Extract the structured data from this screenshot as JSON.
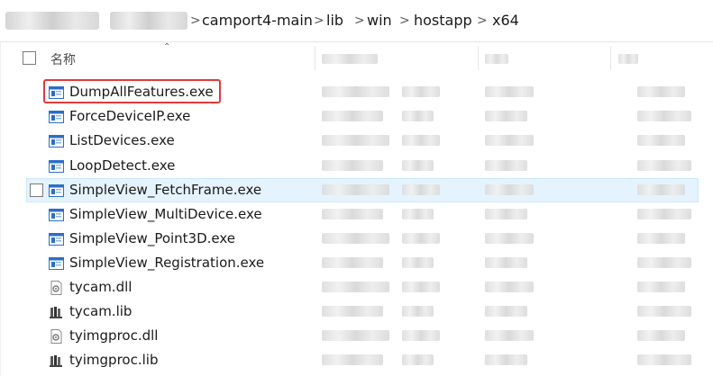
{
  "breadcrumb": {
    "items": [
      "camport4-main",
      "lib",
      "win",
      "hostapp",
      "x64"
    ],
    "separator": ">"
  },
  "columns": {
    "name_label": "名称"
  },
  "files": [
    {
      "name": "DumpAllFeatures.exe",
      "icon": "exe-window-icon",
      "highlighted": true
    },
    {
      "name": "ForceDeviceIP.exe",
      "icon": "exe-window-icon"
    },
    {
      "name": "ListDevices.exe",
      "icon": "exe-window-icon"
    },
    {
      "name": "LoopDetect.exe",
      "icon": "exe-window-icon"
    },
    {
      "name": "SimpleView_FetchFrame.exe",
      "icon": "exe-window-icon",
      "selected": true
    },
    {
      "name": "SimpleView_MultiDevice.exe",
      "icon": "exe-window-icon"
    },
    {
      "name": "SimpleView_Point3D.exe",
      "icon": "exe-window-icon"
    },
    {
      "name": "SimpleView_Registration.exe",
      "icon": "exe-window-icon"
    },
    {
      "name": "tycam.dll",
      "icon": "dll-gear-icon"
    },
    {
      "name": "tycam.lib",
      "icon": "lib-archive-icon"
    },
    {
      "name": "tyimgproc.dll",
      "icon": "dll-gear-icon"
    },
    {
      "name": "tyimgproc.lib",
      "icon": "lib-archive-icon"
    }
  ],
  "colors": {
    "highlight_border": "#e23a3a",
    "selection_bg": "#e5f3ff",
    "exe_icon_blue": "#2a6fc9"
  }
}
